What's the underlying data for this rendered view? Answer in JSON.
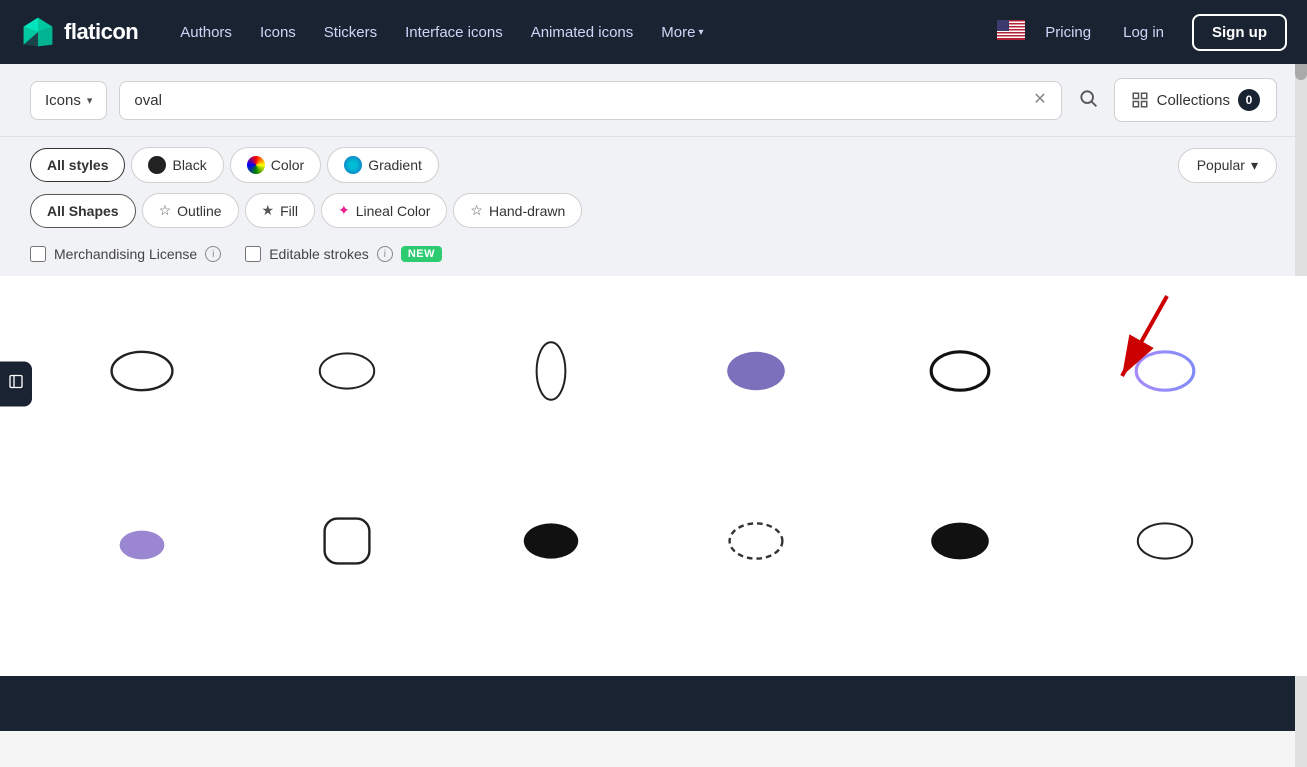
{
  "brand": {
    "name": "flaticon",
    "logo_alt": "Flaticon logo"
  },
  "navbar": {
    "links": [
      {
        "id": "authors",
        "label": "Authors"
      },
      {
        "id": "icons",
        "label": "Icons"
      },
      {
        "id": "stickers",
        "label": "Stickers"
      },
      {
        "id": "interface-icons",
        "label": "Interface icons"
      },
      {
        "id": "animated-icons",
        "label": "Animated icons"
      },
      {
        "id": "more",
        "label": "More",
        "has_arrow": true
      }
    ],
    "pricing": "Pricing",
    "login": "Log in",
    "signup": "Sign up"
  },
  "search": {
    "type_label": "Icons",
    "query": "oval",
    "collections_label": "Collections",
    "collections_count": "0"
  },
  "style_filters": {
    "all_styles_label": "All styles",
    "black_label": "Black",
    "color_label": "Color",
    "gradient_label": "Gradient",
    "popular_label": "Popular"
  },
  "shape_filters": {
    "all_shapes_label": "All Shapes",
    "outline_label": "Outline",
    "fill_label": "Fill",
    "lineal_color_label": "Lineal Color",
    "hand_drawn_label": "Hand-drawn"
  },
  "checkboxes": {
    "merchandising_label": "Merchandising License",
    "editable_label": "Editable strokes",
    "new_badge": "NEW"
  },
  "icons": {
    "row1": [
      {
        "id": "oval-outline-wide",
        "type": "oval-outline-wide"
      },
      {
        "id": "oval-outline-wide2",
        "type": "oval-outline-wide2"
      },
      {
        "id": "oval-outline-tall",
        "type": "oval-outline-tall"
      },
      {
        "id": "oval-fill-purple",
        "type": "oval-fill-purple"
      },
      {
        "id": "oval-outline-thick",
        "type": "oval-outline-thick"
      },
      {
        "id": "oval-outline-gradient",
        "type": "oval-outline-gradient"
      }
    ],
    "row2": [
      {
        "id": "oval-fill-purple-small",
        "type": "oval-fill-purple-small"
      },
      {
        "id": "rounded-rect-outline",
        "type": "rounded-rect-outline"
      },
      {
        "id": "oval-fill-black",
        "type": "oval-fill-black"
      },
      {
        "id": "oval-dashed",
        "type": "oval-dashed"
      },
      {
        "id": "oval-fill-black-wide",
        "type": "oval-fill-black-wide"
      },
      {
        "id": "oval-outline-wide3",
        "type": "oval-outline-wide3"
      }
    ]
  }
}
